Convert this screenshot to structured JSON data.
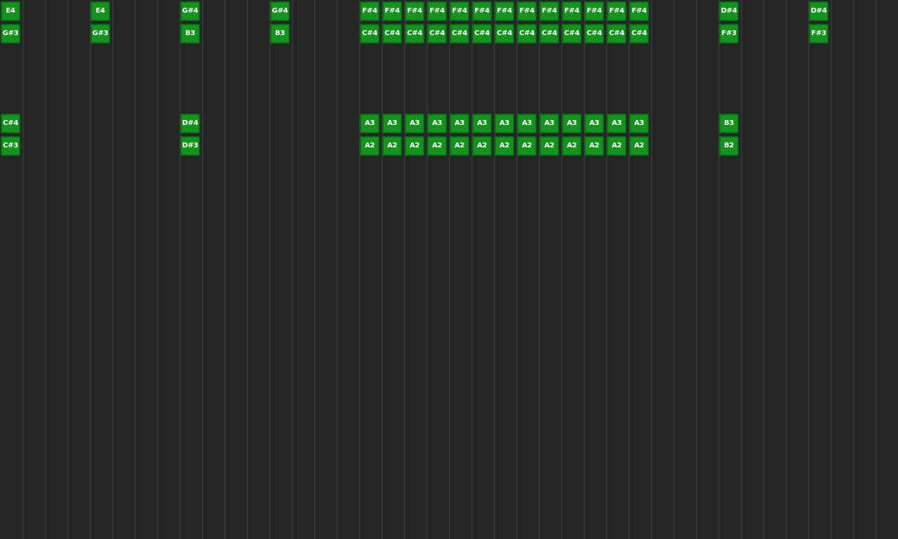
{
  "piano_roll": {
    "columns": 40,
    "note_rows": [
      "E4",
      "G#3",
      "C#4",
      "C#3",
      "G#4",
      "B3",
      "D#4",
      "D#3",
      "F#4",
      "C#4",
      "A3",
      "A2",
      "D#4",
      "F#3",
      "B3",
      "B2"
    ],
    "notes": [
      {
        "col": 0,
        "row": 0,
        "label": "E4"
      },
      {
        "col": 0,
        "row": 1,
        "label": "G#3"
      },
      {
        "col": 0,
        "row": 5,
        "label": "C#4"
      },
      {
        "col": 0,
        "row": 6,
        "label": "C#3"
      },
      {
        "col": 4,
        "row": 0,
        "label": "E4"
      },
      {
        "col": 4,
        "row": 1,
        "label": "G#3"
      },
      {
        "col": 8,
        "row": 0,
        "label": "G#4"
      },
      {
        "col": 8,
        "row": 1,
        "label": "B3"
      },
      {
        "col": 8,
        "row": 5,
        "label": "D#4"
      },
      {
        "col": 8,
        "row": 6,
        "label": "D#3"
      },
      {
        "col": 12,
        "row": 0,
        "label": "G#4"
      },
      {
        "col": 12,
        "row": 1,
        "label": "B3"
      },
      {
        "col": 16,
        "row": 0,
        "label": "F#4"
      },
      {
        "col": 17,
        "row": 0,
        "label": "F#4"
      },
      {
        "col": 18,
        "row": 0,
        "label": "F#4"
      },
      {
        "col": 19,
        "row": 0,
        "label": "F#4"
      },
      {
        "col": 20,
        "row": 0,
        "label": "F#4"
      },
      {
        "col": 21,
        "row": 0,
        "label": "F#4"
      },
      {
        "col": 22,
        "row": 0,
        "label": "F#4"
      },
      {
        "col": 23,
        "row": 0,
        "label": "F#4"
      },
      {
        "col": 24,
        "row": 0,
        "label": "F#4"
      },
      {
        "col": 25,
        "row": 0,
        "label": "F#4"
      },
      {
        "col": 26,
        "row": 0,
        "label": "F#4"
      },
      {
        "col": 27,
        "row": 0,
        "label": "F#4"
      },
      {
        "col": 28,
        "row": 0,
        "label": "F#4"
      },
      {
        "col": 16,
        "row": 1,
        "label": "C#4"
      },
      {
        "col": 17,
        "row": 1,
        "label": "C#4"
      },
      {
        "col": 18,
        "row": 1,
        "label": "C#4"
      },
      {
        "col": 19,
        "row": 1,
        "label": "C#4"
      },
      {
        "col": 20,
        "row": 1,
        "label": "C#4"
      },
      {
        "col": 21,
        "row": 1,
        "label": "C#4"
      },
      {
        "col": 22,
        "row": 1,
        "label": "C#4"
      },
      {
        "col": 23,
        "row": 1,
        "label": "C#4"
      },
      {
        "col": 24,
        "row": 1,
        "label": "C#4"
      },
      {
        "col": 25,
        "row": 1,
        "label": "C#4"
      },
      {
        "col": 26,
        "row": 1,
        "label": "C#4"
      },
      {
        "col": 27,
        "row": 1,
        "label": "C#4"
      },
      {
        "col": 28,
        "row": 1,
        "label": "C#4"
      },
      {
        "col": 16,
        "row": 5,
        "label": "A3"
      },
      {
        "col": 17,
        "row": 5,
        "label": "A3"
      },
      {
        "col": 18,
        "row": 5,
        "label": "A3"
      },
      {
        "col": 19,
        "row": 5,
        "label": "A3"
      },
      {
        "col": 20,
        "row": 5,
        "label": "A3"
      },
      {
        "col": 21,
        "row": 5,
        "label": "A3"
      },
      {
        "col": 22,
        "row": 5,
        "label": "A3"
      },
      {
        "col": 23,
        "row": 5,
        "label": "A3"
      },
      {
        "col": 24,
        "row": 5,
        "label": "A3"
      },
      {
        "col": 25,
        "row": 5,
        "label": "A3"
      },
      {
        "col": 26,
        "row": 5,
        "label": "A3"
      },
      {
        "col": 27,
        "row": 5,
        "label": "A3"
      },
      {
        "col": 28,
        "row": 5,
        "label": "A3"
      },
      {
        "col": 16,
        "row": 6,
        "label": "A2"
      },
      {
        "col": 17,
        "row": 6,
        "label": "A2"
      },
      {
        "col": 18,
        "row": 6,
        "label": "A2"
      },
      {
        "col": 19,
        "row": 6,
        "label": "A2"
      },
      {
        "col": 20,
        "row": 6,
        "label": "A2"
      },
      {
        "col": 21,
        "row": 6,
        "label": "A2"
      },
      {
        "col": 22,
        "row": 6,
        "label": "A2"
      },
      {
        "col": 23,
        "row": 6,
        "label": "A2"
      },
      {
        "col": 24,
        "row": 6,
        "label": "A2"
      },
      {
        "col": 25,
        "row": 6,
        "label": "A2"
      },
      {
        "col": 26,
        "row": 6,
        "label": "A2"
      },
      {
        "col": 27,
        "row": 6,
        "label": "A2"
      },
      {
        "col": 28,
        "row": 6,
        "label": "A2"
      },
      {
        "col": 32,
        "row": 0,
        "label": "D#4"
      },
      {
        "col": 32,
        "row": 1,
        "label": "F#3"
      },
      {
        "col": 32,
        "row": 5,
        "label": "B3"
      },
      {
        "col": 32,
        "row": 6,
        "label": "B2"
      },
      {
        "col": 36,
        "row": 0,
        "label": "D#4"
      },
      {
        "col": 36,
        "row": 1,
        "label": "F#3"
      }
    ]
  },
  "colors": {
    "background": "#262628",
    "grid_line": "#3c3c3f",
    "note_fill": "#16a223",
    "note_border": "#0a6e12",
    "note_text": "#ffffff"
  }
}
